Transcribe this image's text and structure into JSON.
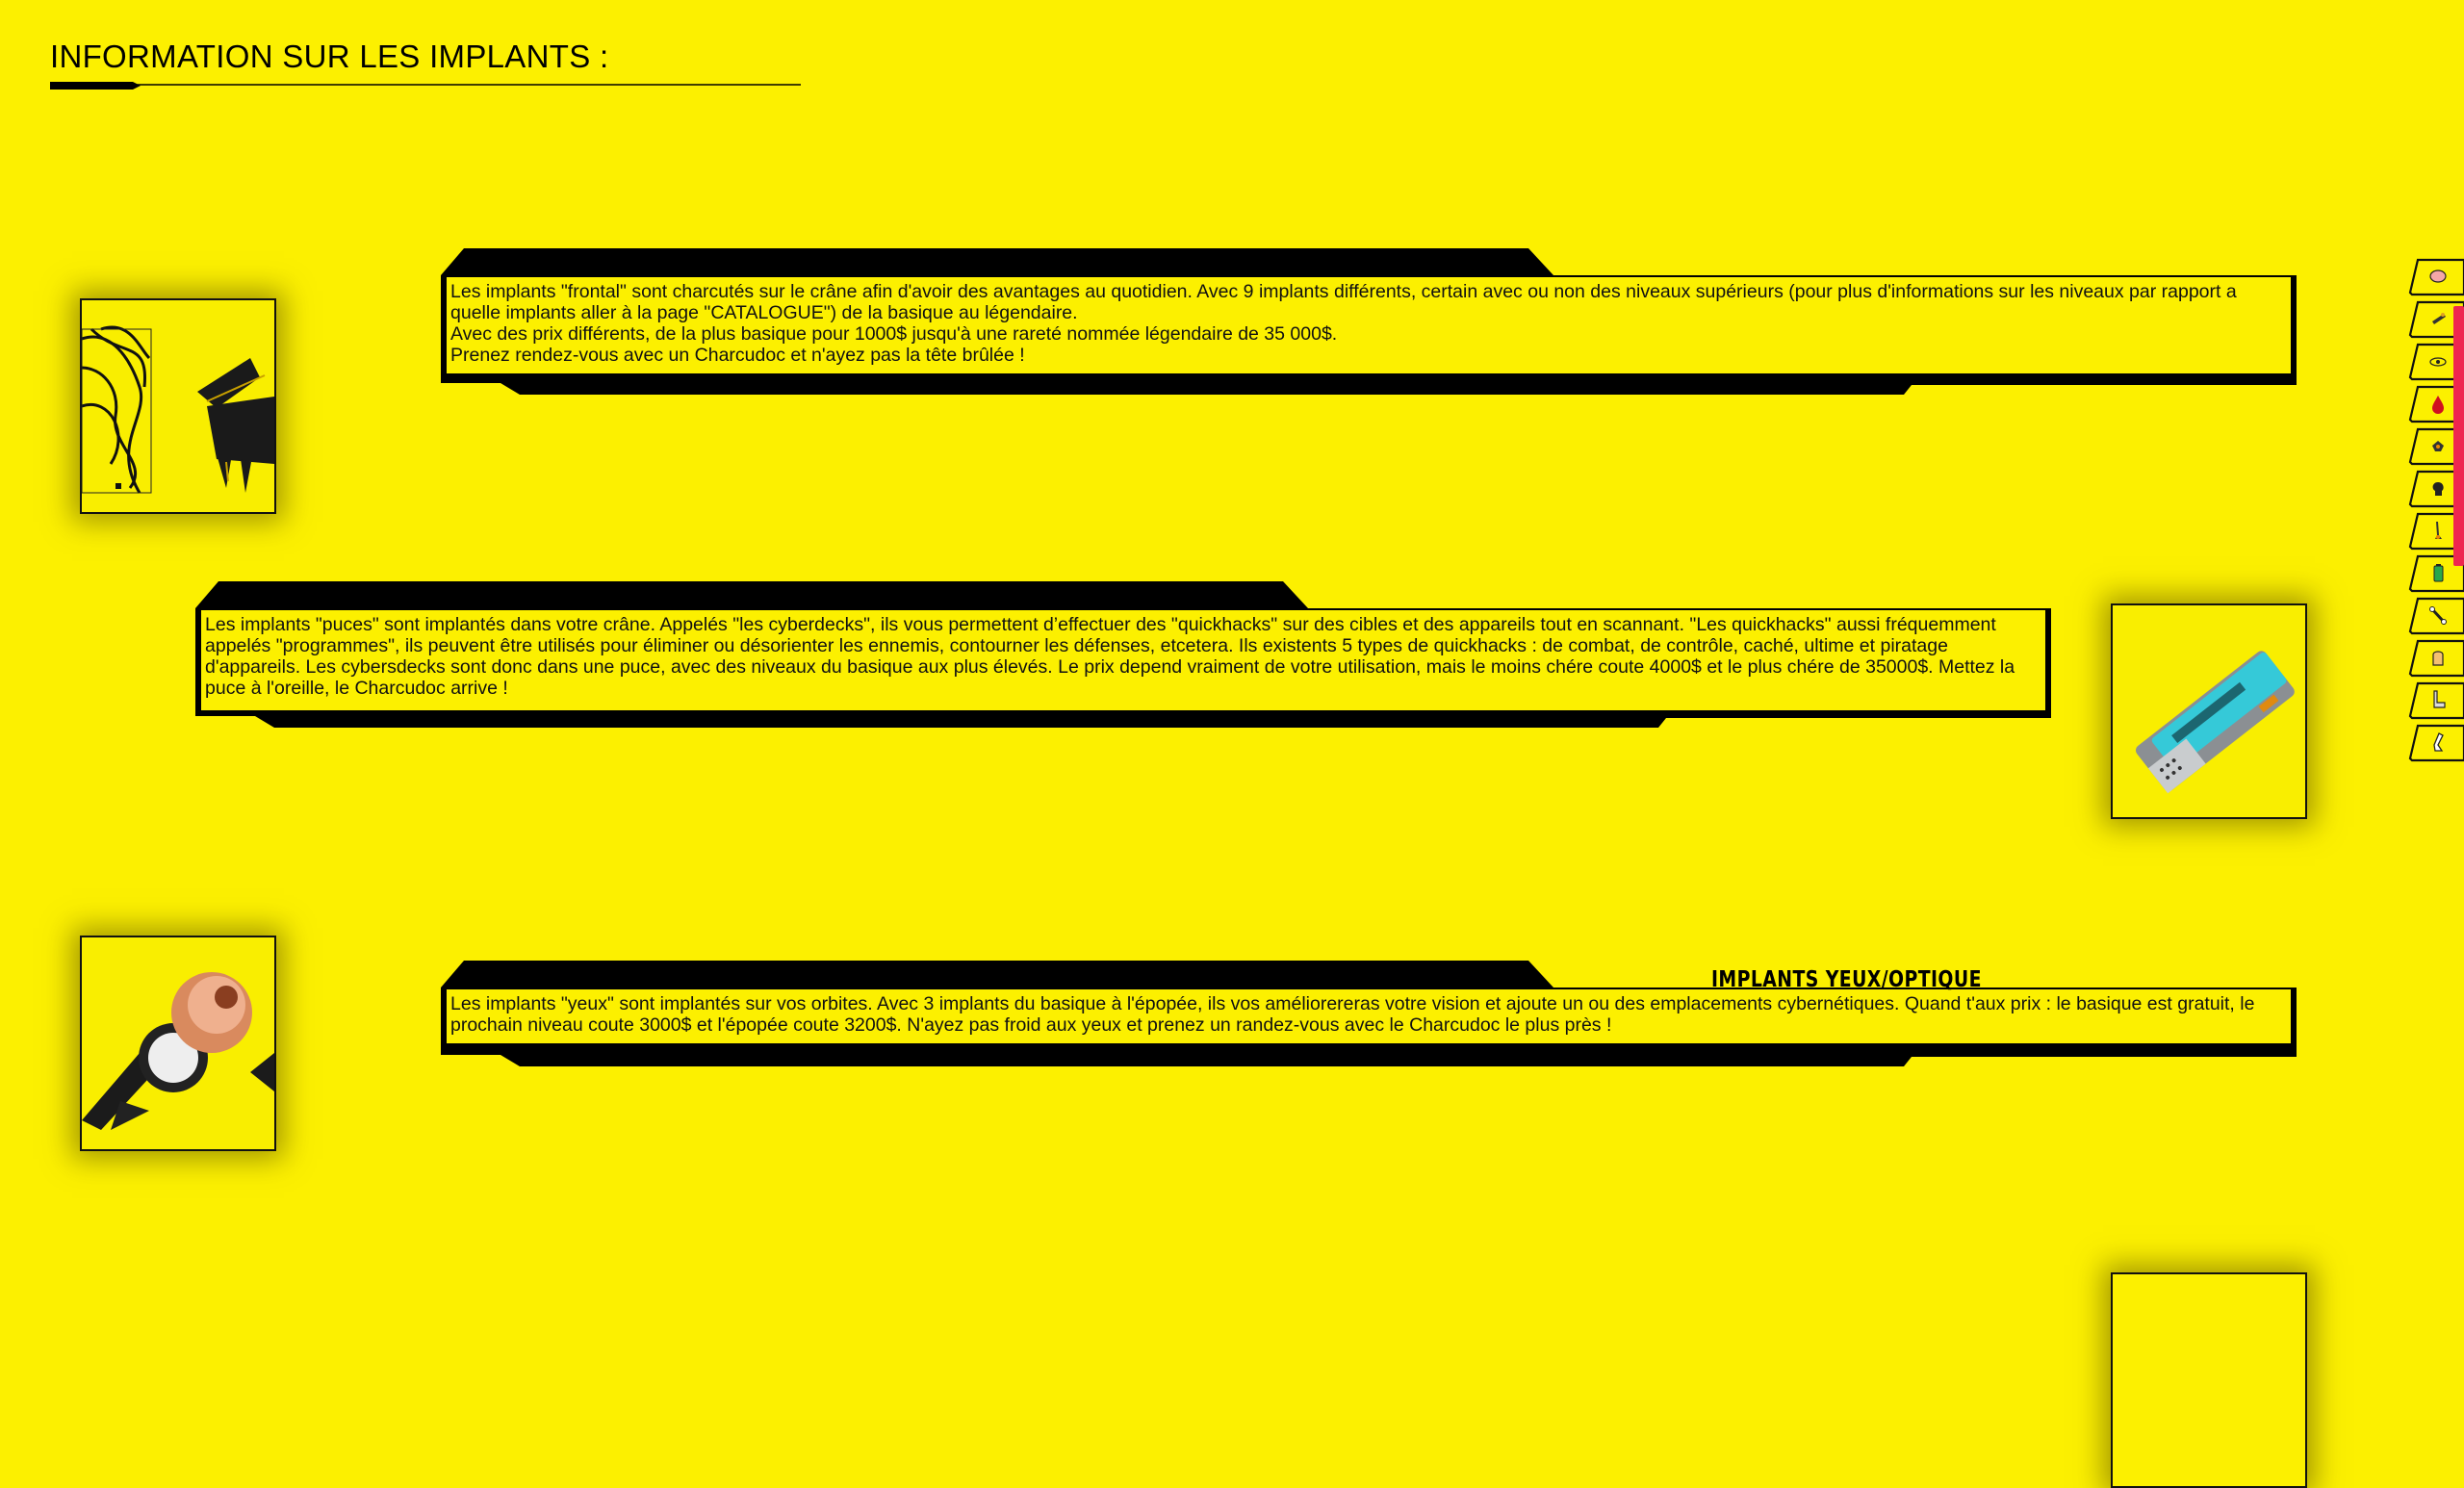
{
  "page": {
    "title": "INFORMATION SUR LES IMPLANTS :"
  },
  "panels": [
    {
      "text": "Les implants \"frontal\" sont charcutés sur le crâne afin d'avoir des avantages au quotidien. Avec 9 implants différents, certain avec ou non des niveaux supérieurs (pour plus d'informations sur les niveaux par rapport a quelle implants aller à la page \"CATALOGUE\") de la basique au légendaire.\nAvec des prix différents, de la plus basique pour 1000$ jusqu'à une rareté nommée légendaire de 35 000$.\nPrenez rendez-vous avec un Charcudoc et n'ayez pas la tête brûlée !"
    },
    {
      "text": "Les implants \"puces\" sont implantés dans votre crâne. Appelés \"les cyberdecks\", ils vous permettent d’effectuer des \"quickhacks\" sur des cibles et des appareils tout en scannant. \"Les quickhacks\" aussi fréquemment appelés \"programmes\", ils peuvent être utilisés pour éliminer ou désorienter les ennemis, contourner les défenses, etcetera. Ils existents 5 types de quickhacks : de combat, de contrôle, caché, ultime et piratage d'appareils. Les cybersdecks sont donc dans une puce, avec des niveaux du basique aux plus élevés. Le prix depend vraiment de votre utilisation, mais le moins chére coute 4000$ et le plus chére de 35000$. Mettez la puce à l'oreille, le Charcudoc arrive !"
    },
    {
      "label": "IMPLANTS YEUX/OPTIQUE",
      "text": "Les implants \"yeux\" sont implantés sur vos orbites. Avec 3 implants du basique à l'épopée, ils vos améliorereras votre vision et ajoute un ou des emplacements cybernétiques. Quand t'aux prix : le basique est gratuit, le prochain niveau coute 3000$ et l'épopée coute 3200$. N'ayez pas froid aux yeux et prenez un randez-vous avec le Charcudoc le plus près !"
    }
  ],
  "images": [
    {
      "name": "frontal-implant-image"
    },
    {
      "name": "chip-implant-image"
    },
    {
      "name": "eye-implant-image"
    },
    {
      "name": "next-implant-image"
    }
  ],
  "side_nav": [
    "brain-icon",
    "chip-icon",
    "eye-icon",
    "blood-drop-icon",
    "heart-icon",
    "head-silhouette-icon",
    "bone-leg-icon",
    "battery-icon",
    "bone-icon",
    "hand-icon",
    "arm-icon",
    "leg-icon"
  ],
  "colors": {
    "background": "#fcf000",
    "ink": "#000000",
    "scroll_accent": "#ee2650"
  }
}
